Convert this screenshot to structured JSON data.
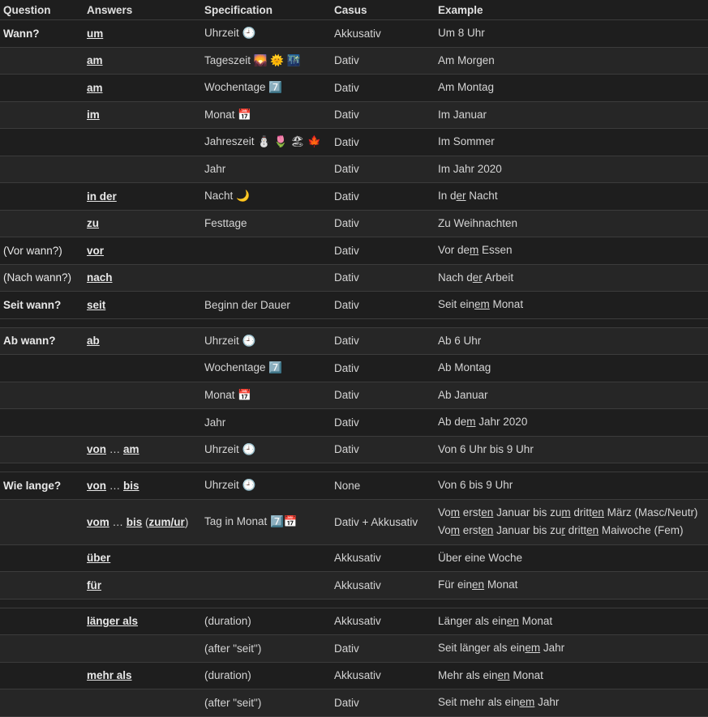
{
  "headers": [
    "Question",
    "Answers",
    "Specification",
    "Casus",
    "Example"
  ],
  "rows": [
    {
      "q": "Wann?",
      "a": "um",
      "s": "Uhrzeit 🕘",
      "c": "Akkusativ",
      "e": [
        [
          [
            "Um 8 Uhr",
            false
          ]
        ]
      ]
    },
    {
      "q": "",
      "a": "am",
      "s": "Tageszeit 🌄 🌞 🌃",
      "c": "Dativ",
      "e": [
        [
          [
            "Am Morgen",
            false
          ]
        ]
      ]
    },
    {
      "q": "",
      "a": "am",
      "s": "Wochentage 7️⃣",
      "c": "Dativ",
      "e": [
        [
          [
            "Am Montag",
            false
          ]
        ]
      ]
    },
    {
      "q": "",
      "a": "im",
      "s": "Monat 📅",
      "c": "Dativ",
      "e": [
        [
          [
            "Im Januar",
            false
          ]
        ]
      ]
    },
    {
      "q": "",
      "a": "",
      "s": "Jahreszeit ⛄ 🌷 🏖 🍁",
      "c": "Dativ",
      "e": [
        [
          [
            "Im Sommer",
            false
          ]
        ]
      ]
    },
    {
      "q": "",
      "a": "",
      "s": "Jahr",
      "c": "Dativ",
      "e": [
        [
          [
            "Im Jahr 2020",
            false
          ]
        ]
      ]
    },
    {
      "q": "",
      "a": "in der",
      "s": "Nacht 🌙",
      "c": "Dativ",
      "e": [
        [
          [
            "In d",
            false
          ],
          [
            "er",
            true
          ],
          [
            " Nacht",
            false
          ]
        ]
      ]
    },
    {
      "q": "",
      "a": "zu",
      "s": "Festtage",
      "c": "Dativ",
      "e": [
        [
          [
            "Zu Weihnachten",
            false
          ]
        ]
      ]
    },
    {
      "q": "(Vor wann?)",
      "qn": true,
      "a": "vor",
      "s": "",
      "c": "Dativ",
      "e": [
        [
          [
            "Vor de",
            false
          ],
          [
            "m",
            true
          ],
          [
            " Essen",
            false
          ]
        ]
      ]
    },
    {
      "q": "(Nach wann?)",
      "qn": true,
      "a": "nach",
      "s": "",
      "c": "Dativ",
      "e": [
        [
          [
            "Nach d",
            false
          ],
          [
            "er",
            true
          ],
          [
            " Arbeit",
            false
          ]
        ]
      ]
    },
    {
      "q": "Seit wann?",
      "a": "seit",
      "s": "Beginn der Dauer",
      "c": "Dativ",
      "e": [
        [
          [
            "Seit ein",
            false
          ],
          [
            "em",
            true
          ],
          [
            " Monat",
            false
          ]
        ]
      ]
    },
    {
      "spacer": true
    },
    {
      "q": "Ab wann?",
      "a": "ab",
      "s": "Uhrzeit 🕘",
      "c": "Dativ",
      "e": [
        [
          [
            "Ab 6 Uhr",
            false
          ]
        ]
      ]
    },
    {
      "q": "",
      "a": "",
      "s": "Wochentage 7️⃣",
      "c": "Dativ",
      "e": [
        [
          [
            "Ab Montag",
            false
          ]
        ]
      ]
    },
    {
      "q": "",
      "a": "",
      "s": "Monat 📅",
      "c": "Dativ",
      "e": [
        [
          [
            "Ab Januar",
            false
          ]
        ]
      ]
    },
    {
      "q": "",
      "a": "",
      "s": "Jahr",
      "c": "Dativ",
      "e": [
        [
          [
            "Ab de",
            false
          ],
          [
            "m",
            true
          ],
          [
            " Jahr 2020",
            false
          ]
        ]
      ]
    },
    {
      "q": "",
      "a": [
        [
          "von",
          true
        ],
        [
          " … ",
          false
        ],
        [
          "am",
          true
        ]
      ],
      "s": "Uhrzeit 🕘",
      "c": "Dativ",
      "e": [
        [
          [
            "Von 6 Uhr bis 9 Uhr",
            false
          ]
        ]
      ]
    },
    {
      "spacer": true
    },
    {
      "q": "Wie lange?",
      "a": [
        [
          "von",
          true
        ],
        [
          " … ",
          false
        ],
        [
          "bis",
          true
        ]
      ],
      "s": "Uhrzeit 🕘",
      "c": "None",
      "e": [
        [
          [
            "Von 6 bis 9 Uhr",
            false
          ]
        ]
      ]
    },
    {
      "q": "",
      "tall": true,
      "a": [
        [
          "vom",
          true
        ],
        [
          " … ",
          false
        ],
        [
          "bis",
          true
        ],
        [
          " (",
          false
        ],
        [
          "zum/ur",
          true
        ],
        [
          ")",
          false
        ]
      ],
      "s": "Tag in Monat 7️⃣📅",
      "c": "Dativ + Akkusativ",
      "e": [
        [
          [
            "Vo",
            false
          ],
          [
            "m",
            true
          ],
          [
            " erst",
            false
          ],
          [
            "en",
            true
          ],
          [
            " Januar bis zu",
            false
          ],
          [
            "m",
            true
          ],
          [
            " dritt",
            false
          ],
          [
            "en",
            true
          ],
          [
            " März (Masc/Neutr)",
            false
          ]
        ],
        [
          [
            "Vo",
            false
          ],
          [
            "m",
            true
          ],
          [
            " erst",
            false
          ],
          [
            "en",
            true
          ],
          [
            " Januar bis zu",
            false
          ],
          [
            "r",
            true
          ],
          [
            " dritt",
            false
          ],
          [
            "en",
            true
          ],
          [
            " Maiwoche (Fem)",
            false
          ]
        ]
      ]
    },
    {
      "q": "",
      "a": "über",
      "s": "",
      "c": "Akkusativ",
      "e": [
        [
          [
            "Über eine Woche",
            false
          ]
        ]
      ]
    },
    {
      "q": "",
      "a": "für",
      "s": "",
      "c": "Akkusativ",
      "e": [
        [
          [
            "Für ein",
            false
          ],
          [
            "en",
            true
          ],
          [
            " Monat",
            false
          ]
        ]
      ]
    },
    {
      "spacer": true
    },
    {
      "q": "",
      "a": "länger als",
      "s": "(duration)",
      "c": "Akkusativ",
      "e": [
        [
          [
            "Länger als ein",
            false
          ],
          [
            "en",
            true
          ],
          [
            " Monat",
            false
          ]
        ]
      ]
    },
    {
      "q": "",
      "a": "",
      "s": "(after \"seit\")",
      "c": "Dativ",
      "e": [
        [
          [
            "Seit länger als ein",
            false
          ],
          [
            "em",
            true
          ],
          [
            " Jahr",
            false
          ]
        ]
      ]
    },
    {
      "q": "",
      "a": "mehr als",
      "s": "(duration)",
      "c": "Akkusativ",
      "e": [
        [
          [
            "Mehr als ein",
            false
          ],
          [
            "en",
            true
          ],
          [
            " Monat",
            false
          ]
        ]
      ]
    },
    {
      "q": "",
      "a": "",
      "s": "(after \"seit\")",
      "c": "Dativ",
      "e": [
        [
          [
            "Seit mehr als ein",
            false
          ],
          [
            "em",
            true
          ],
          [
            " Jahr",
            false
          ]
        ]
      ]
    }
  ]
}
